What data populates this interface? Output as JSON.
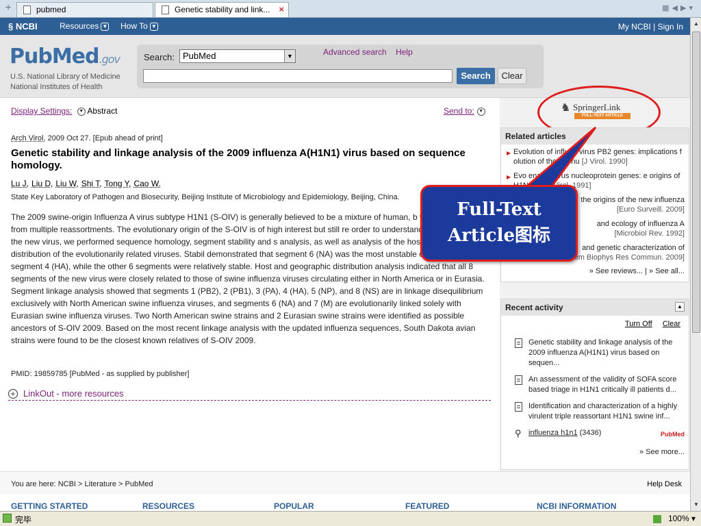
{
  "browser": {
    "tabs": [
      {
        "label": "pubmed"
      },
      {
        "label": "Genetic stability and link..."
      }
    ],
    "status": "完毕",
    "zoom": "100%"
  },
  "ncbi": {
    "logo": "NCBI",
    "nav": [
      "Resources",
      "How To"
    ],
    "signin": "My NCBI | Sign In"
  },
  "header": {
    "logo_main": "PubMed",
    "logo_suffix": ".gov",
    "nlm_line1": "U.S. National Library of Medicine",
    "nlm_line2": "National Institutes of Health",
    "search_label": "Search:",
    "db_value": "PubMed",
    "advanced": "Advanced search",
    "help": "Help",
    "search_btn": "Search",
    "clear_btn": "Clear"
  },
  "main": {
    "display_settings": "Display Settings:",
    "display_mode": "Abstract",
    "send_to": "Send to:",
    "journal": "Arch Virol.",
    "citation_rest": " 2009 Oct 27. [Epub ahead of print]",
    "title": "Genetic stability and linkage analysis of the 2009 influenza A(H1N1) virus based on sequence homology.",
    "authors": [
      "Lu J,",
      "Liu D,",
      "Liu W,",
      "Shi T,",
      "Tong Y,",
      "Cao W."
    ],
    "affiliation": "State Key Laboratory of Pathogen and Biosecurity, Beijing Institute of Microbiology and Epidemiology, Beijing, China.",
    "abstract": "The 2009 swine-origin Influenza A virus subtype H1N1 (S-OIV) is generally believed to be a mixture of human, b viruses, resulting from multiple reassortments. The evolutionary origin of the S-OIV is of high interest but still re order to understand the evolution of the new virus, we performed sequence homology, segment stability and s analysis, as well as analysis of the host and geographic distribution of the evolutionarily related viruses. Stabil demonstrated that segment 6 (NA) was the most unstable one, followed by segment 4 (HA), while the other 6 segments were relatively stable. Host and geographic distribution analysis indicated that all 8 segments of the new virus were closely related to those of swine influenza viruses circulating either in North America or in Eurasia. Segment linkage analysis showed that segments 1 (PB2), 2 (PB1), 3 (PA), 4 (HA), 5 (NP), and 8 (NS) are in linkage disequilibrium exclusively with North American swine influenza viruses, and segments 6 (NA) and 7 (M) are evolutionarily linked solely with Eurasian swine influenza viruses. Two North American swine strains and 2 Eurasian swine strains were identified as possible ancestors of S-OIV 2009. Based on the most recent linkage analysis with the updated influenza sequences, South Dakota avian strains were found to be the closest known relatives of S-OIV 2009.",
    "pmid": "PMID: 19859785 [PubMed - as supplied by publisher]",
    "linkout": "LinkOut - more resources"
  },
  "sidebar": {
    "springer_name": "SpringerLink",
    "springer_badge": "FULL-TEXT ARTICLE",
    "related_title": "Related articles",
    "related": [
      {
        "text": "Evolution of influen    virus PB2 genes: implications f   olution of the ribonu",
        "src": "[J Virol. 1990]"
      },
      {
        "text": "Evo    enza A virus nucleoprotein genes: e origins of H1N1 hu",
        "src": "[J Virol. 1991]"
      },
      {
        "text": "the origins of the new influenza",
        "src": "[Euro Surveill. 2009]"
      },
      {
        "text": "and ecology of influenza A",
        "src": "[Microbiol Rev. 1992]"
      },
      {
        "text": "and genetic characterization of",
        "src": "hem Biophys Res Commun. 2009]"
      }
    ],
    "related_more": "» See reviews... | » See all...",
    "recent_title": "Recent activity",
    "turn_off": "Turn Off",
    "clear": "Clear",
    "recent": [
      "Genetic stability and linkage analysis of the 2009 influenza A(H1N1) virus based on sequen...",
      "An assessment of the validity of SOFA score based triage in H1N1 critically ill patients d...",
      "Identification and characterization of a highly virulent triple reassortant H1N1 swine inf..."
    ],
    "recent_search": "influenza h1n1",
    "recent_search_count": " (3436)",
    "recent_search_tag": "PubMed",
    "see_more": "» See more..."
  },
  "callout": {
    "line1": "Full-Text",
    "line2": "Article图标",
    "color": "#1c3a9b",
    "border": "#e01c1c"
  },
  "footer": {
    "breadcrumb": "You are here: NCBI > Literature > PubMed",
    "help_desk": "Help Desk",
    "categories": [
      "GETTING STARTED",
      "RESOURCES",
      "POPULAR",
      "FEATURED",
      "NCBI INFORMATION"
    ]
  }
}
